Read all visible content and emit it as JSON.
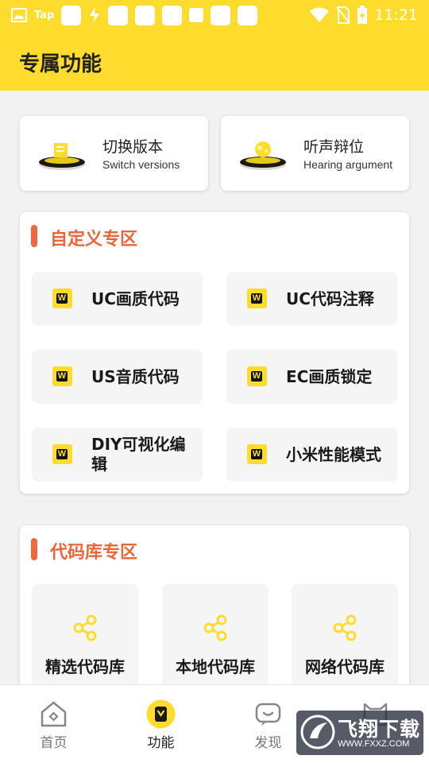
{
  "status_bar": {
    "tap_label": "Tap",
    "time": "11:21"
  },
  "header": {
    "title": "专属功能"
  },
  "mode_cards": [
    {
      "title": "切换版本",
      "subtitle": "Switch versions",
      "icon": "switch-version-icon"
    },
    {
      "title": "听声辩位",
      "subtitle": "Hearing argument",
      "icon": "hearing-icon"
    }
  ],
  "custom_section": {
    "title": "自定义专区",
    "items": [
      {
        "label": "UC画质代码"
      },
      {
        "label": "UC代码注释"
      },
      {
        "label": "US音质代码"
      },
      {
        "label": "EC画质锁定"
      },
      {
        "label": "DIY可视化编辑"
      },
      {
        "label": "小米性能模式"
      }
    ],
    "icon_glyph": "W"
  },
  "library_section": {
    "title": "代码库专区",
    "items": [
      {
        "label": "精选代码库"
      },
      {
        "label": "本地代码库"
      },
      {
        "label": "网络代码库"
      }
    ]
  },
  "bottom_nav": {
    "items": [
      {
        "label": "首页",
        "icon": "home-icon",
        "active": false
      },
      {
        "label": "功能",
        "icon": "function-icon",
        "active": true
      },
      {
        "label": "发现",
        "icon": "discover-icon",
        "active": false
      },
      {
        "label": "",
        "icon": "cat-icon",
        "active": false
      }
    ]
  },
  "watermark": {
    "main": "飞翔下载",
    "url": "WWW.FXXZ.COM"
  },
  "colors": {
    "brand_yellow": "#fedc2d",
    "accent_orange": "#e8663a",
    "background": "#f2f2f2"
  }
}
